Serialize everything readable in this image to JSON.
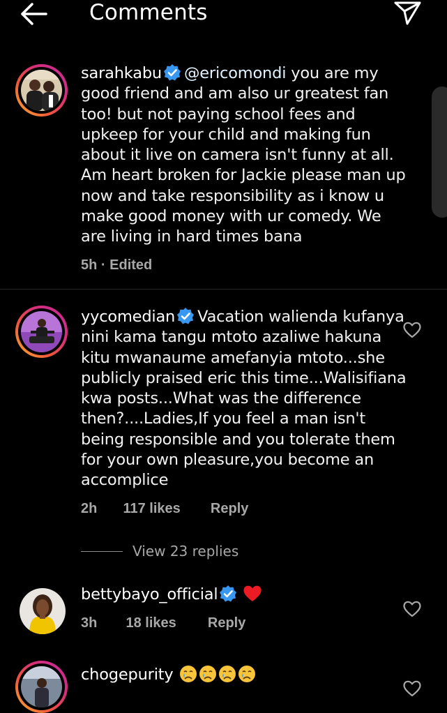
{
  "header": {
    "title": "Comments"
  },
  "comments": [
    {
      "username": "sarahkabu",
      "mention": "@ericomondi",
      "text": " you are my good friend and am also ur greatest fan too! but not paying school fees and upkeep for your child and making fun about it live on camera isn't funny at all. Am heart broken for Jackie please man up now and take responsibility as i know u make good money with ur comedy. We are living in hard times bana",
      "time": "5h",
      "separator": "·",
      "edited": "Edited"
    },
    {
      "username": "yycomedian",
      "text": "Vacation walienda kufanya nini kama tangu mtoto azaliwe hakuna kitu mwanaume amefanyia mtoto...she publicly praised eric this time...Walisifiana kwa posts...What was the difference then?....Ladies,If you feel a man isn't being responsible and you tolerate them for your own pleasure,you become an accomplice",
      "time": "2h",
      "likes": "117 likes",
      "reply": "Reply",
      "view_replies": "View 23 replies"
    },
    {
      "username": "bettybayo_official",
      "emoji": "red-heart",
      "time": "3h",
      "likes": "18 likes",
      "reply": "Reply"
    },
    {
      "username": "chogepurity",
      "emoji": "crying-face x4"
    }
  ],
  "colors": {
    "background": "#000000",
    "text": "#ffffff",
    "meta": "#a8a8a8",
    "verified": "#3897f0",
    "heart_red": "#ed1c24"
  }
}
